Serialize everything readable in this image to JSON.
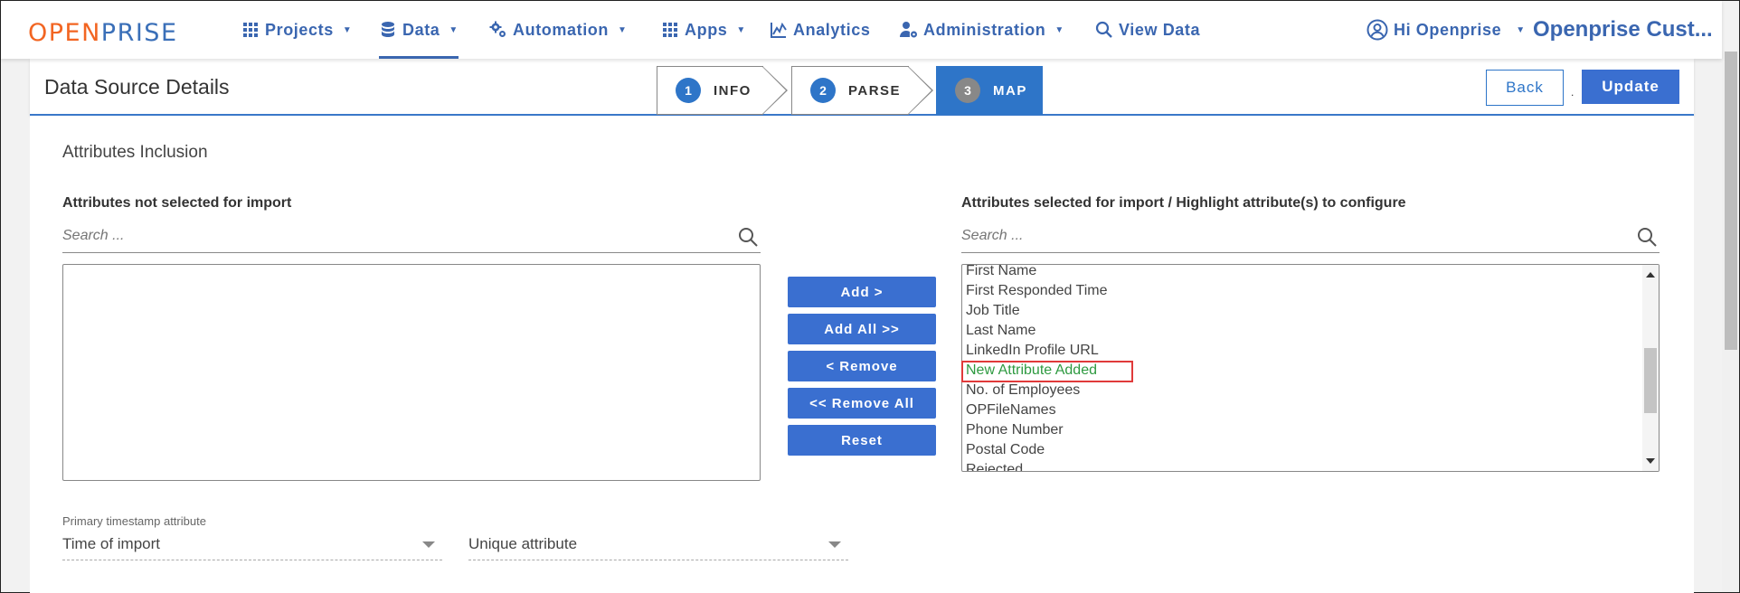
{
  "logo": {
    "open": "OPEN",
    "prise": "PRISE"
  },
  "nav": {
    "projects": "Projects",
    "data": "Data",
    "automation": "Automation",
    "apps": "Apps",
    "analytics": "Analytics",
    "administration": "Administration",
    "view_data": "View Data",
    "user_greeting": "Hi Openprise",
    "customer": "Openprise Cust..."
  },
  "header": {
    "title": "Data Source Details",
    "steps": [
      {
        "num": "1",
        "label": "INFO"
      },
      {
        "num": "2",
        "label": "PARSE"
      },
      {
        "num": "3",
        "label": "MAP"
      }
    ],
    "back_label": "Back",
    "separator": ".",
    "update_label": "Update"
  },
  "content": {
    "section_title": "Attributes Inclusion",
    "left_panel": {
      "label": "Attributes not selected for import",
      "search_placeholder": "Search ..."
    },
    "right_panel": {
      "label": "Attributes selected for import / Highlight attribute(s) to configure",
      "search_placeholder": "Search ...",
      "items": [
        "First Name",
        "First Responded Time",
        "Job Title",
        "Last Name",
        "LinkedIn Profile URL",
        "New Attribute Added",
        "No. of Employees",
        "OPFileNames",
        "Phone Number",
        "Postal Code",
        "Rejected"
      ]
    },
    "buttons": {
      "add": "Add >",
      "add_all": "Add All >>",
      "remove": "< Remove",
      "remove_all": "<< Remove All",
      "reset": "Reset"
    },
    "primary_timestamp": {
      "label": "Primary timestamp attribute",
      "value": "Time of import"
    },
    "unique_attribute": {
      "value": "Unique attribute"
    }
  },
  "colors": {
    "brand_orange": "#f26522",
    "brand_blue": "#3a6fb8",
    "button_blue": "#3a6fd0",
    "highlight_green": "#2e9a40",
    "highlight_border": "#e03a3a"
  }
}
